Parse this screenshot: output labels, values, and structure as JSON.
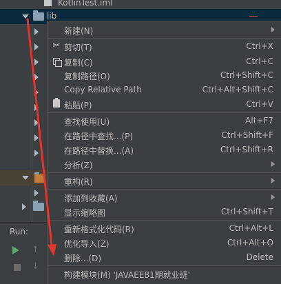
{
  "project_tree": {
    "file_item": "KotlinTest.iml",
    "folder_item": "lib"
  },
  "run_panel": {
    "label": "Run:"
  },
  "context_menu": {
    "items": [
      {
        "label": "新建(N)",
        "shortcut": "",
        "submenu": true
      },
      {
        "label": "剪切(T)",
        "shortcut": "Ctrl+X",
        "submenu": false,
        "icon": "scissors-icon"
      },
      {
        "label": "复制(C)",
        "shortcut": "Ctrl+C",
        "submenu": false,
        "icon": "copy-icon"
      },
      {
        "label": "复制路径(O)",
        "shortcut": "Ctrl+Shift+C",
        "submenu": false
      },
      {
        "label": "Copy Relative Path",
        "shortcut": "Ctrl+Alt+Shift+C",
        "submenu": false
      },
      {
        "label": "粘贴(P)",
        "shortcut": "Ctrl+V",
        "submenu": false,
        "icon": "paste-icon"
      },
      {
        "label": "查找使用(U)",
        "shortcut": "Alt+F7",
        "submenu": false
      },
      {
        "label": "在路径中查找...(P)",
        "shortcut": "Ctrl+Shift+F",
        "submenu": false
      },
      {
        "label": "在路径中替换...(A)",
        "shortcut": "Ctrl+Shift+R",
        "submenu": false
      },
      {
        "label": "分析(Z)",
        "shortcut": "",
        "submenu": true
      },
      {
        "label": "重构(R)",
        "shortcut": "",
        "submenu": true
      },
      {
        "label": "添加到收藏(A)",
        "shortcut": "",
        "submenu": true
      },
      {
        "label": "显示缩略图",
        "shortcut": "Ctrl+Shift+T",
        "submenu": false
      },
      {
        "label": "重新格式化代码(R)",
        "shortcut": "Ctrl+Alt+L",
        "submenu": false
      },
      {
        "label": "优化导入(Z)",
        "shortcut": "Ctrl+Alt+O",
        "submenu": false
      },
      {
        "label": "删除...(D)",
        "shortcut": "Delete",
        "submenu": false
      },
      {
        "label": "构建模块(M) 'JAVAEE81期就业班'",
        "shortcut": "",
        "submenu": false
      }
    ]
  },
  "colors": {
    "background": "#3c3f41",
    "selection": "#0d293e",
    "annotation_arrow": "#e3342f"
  }
}
